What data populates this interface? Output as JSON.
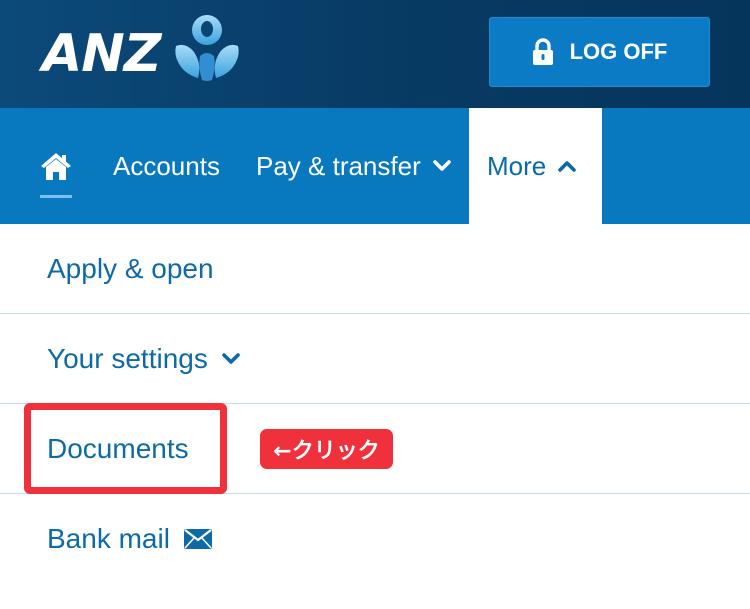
{
  "header": {
    "logo_text": "ANZ",
    "logoff_label": "LOG OFF"
  },
  "nav": {
    "items": [
      {
        "id": "home",
        "icon": "home-icon",
        "label": ""
      },
      {
        "id": "accounts",
        "label": "Accounts"
      },
      {
        "id": "pay",
        "label": "Pay & transfer",
        "icon": "chevron-down-icon"
      },
      {
        "id": "more",
        "label": "More",
        "icon": "chevron-up-icon",
        "active": true
      }
    ]
  },
  "menu": {
    "items": [
      {
        "label": "Apply & open"
      },
      {
        "label": "Your settings",
        "icon": "chevron-down-icon"
      },
      {
        "label": "Documents",
        "highlighted": true
      },
      {
        "label": "Bank mail",
        "icon": "envelope-icon"
      }
    ]
  },
  "annotation": {
    "badge_text": "←クリック"
  },
  "colors": {
    "header_bg": "#073a63",
    "nav_bg": "#0878bf",
    "link_blue": "#0d6aa6",
    "highlight_red": "#f0303a"
  }
}
